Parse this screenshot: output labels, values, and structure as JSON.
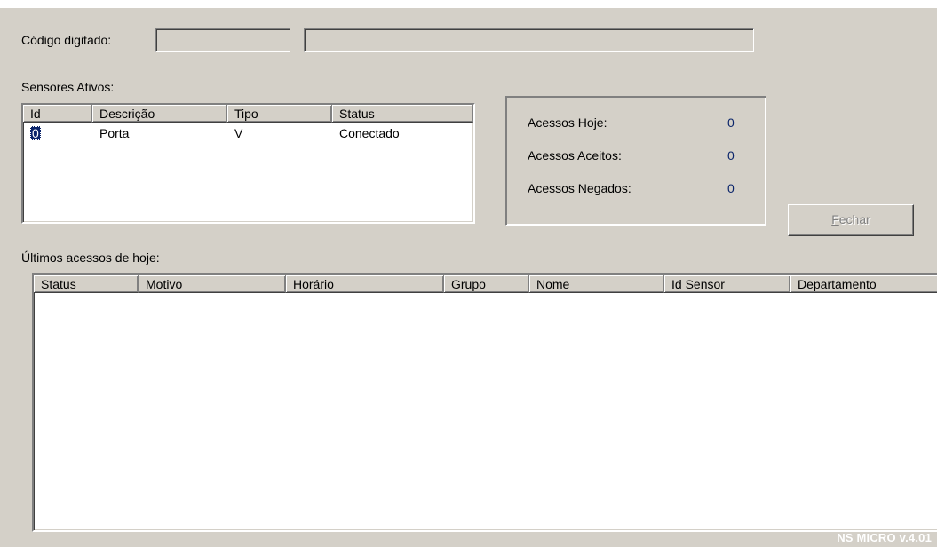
{
  "codigo": {
    "label": "Código digitado:",
    "value1": "",
    "value2": ""
  },
  "sensores": {
    "label": "Sensores Ativos:",
    "columns": [
      "Id",
      "Descrição",
      "Tipo",
      "Status"
    ],
    "rows": [
      {
        "id": "0",
        "descricao": "Porta",
        "tipo": "V",
        "status": "Conectado"
      }
    ]
  },
  "stats": {
    "hoje_label": "Acessos Hoje:",
    "hoje_value": "0",
    "aceitos_label": "Acessos Aceitos:",
    "aceitos_value": "0",
    "negados_label": "Acessos Negados:",
    "negados_value": "0"
  },
  "fechar_button": {
    "label": "Fechar",
    "mnemonic": "F",
    "rest": "echar",
    "enabled": false
  },
  "ultimos": {
    "label": "Últimos acessos de hoje:",
    "columns": [
      "Status",
      "Motivo",
      "Horário",
      "Grupo",
      "Nome",
      "Id Sensor",
      "Departamento"
    ],
    "rows": []
  },
  "footer": {
    "version": "NS MICRO v.4.01"
  },
  "colors": {
    "window_bg": "#d4d0c8",
    "selection": "#0a246a",
    "value_text": "#0a246a"
  }
}
